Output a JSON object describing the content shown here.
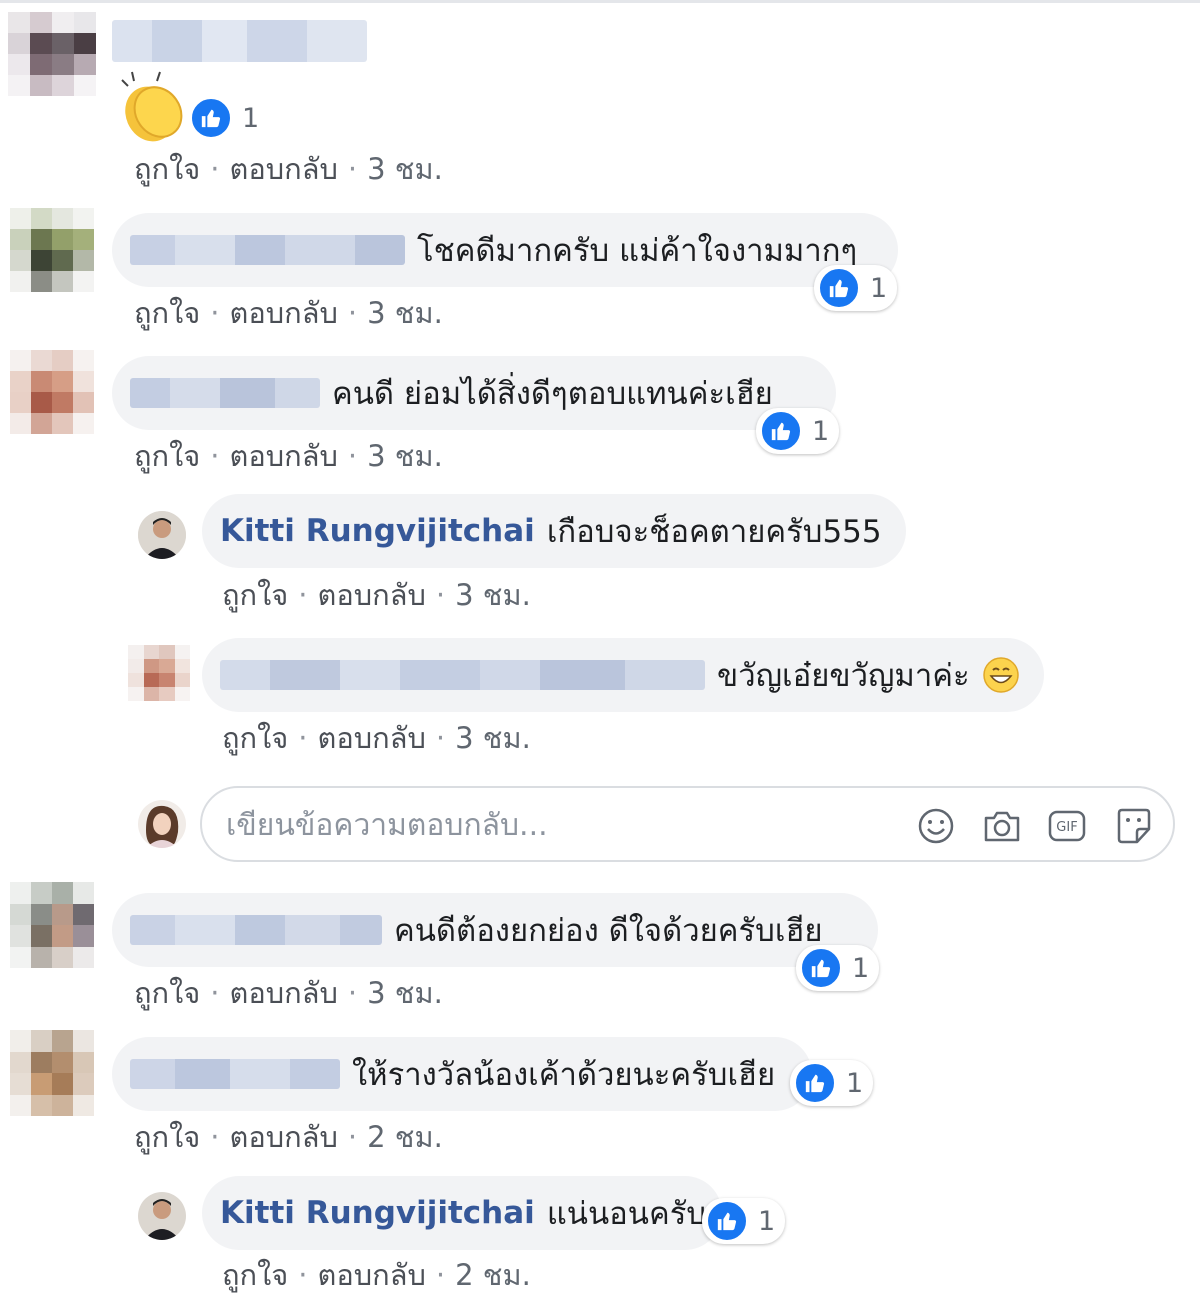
{
  "actions": {
    "like": "ถูกใจ",
    "reply": "ตอบกลับ",
    "separator": "·"
  },
  "comments": [
    {
      "text": "",
      "time": "3 ชม.",
      "reaction_count": "1",
      "sticker": "clapping-hands-emoji"
    },
    {
      "text": "โชคดีมากครับ แม่ค้าใจงามมากๆ",
      "time": "3 ชม.",
      "reaction_count": "1"
    },
    {
      "text": "คนดี ย่อมได้สิ่งดีๆตอบแทนค่ะเฮีย",
      "time": "3 ชม.",
      "reaction_count": "1"
    },
    {
      "author": "Kitti Rungvijitchai",
      "text": "เกือบจะช็อคตายครับ555",
      "time": "3 ชม."
    },
    {
      "text": "ขวัญเอ๋ยขวัญมาค่ะ",
      "emoji": "grinning-face",
      "time": "3 ชม."
    },
    {
      "text": "คนดีต้องยกย่อง ดีใจด้วยครับเฮีย",
      "time": "3 ชม.",
      "reaction_count": "1"
    },
    {
      "text": "ให้รางวัลน้องเค้าด้วยนะครับเฮีย",
      "time": "2 ชม.",
      "reaction_count": "1"
    },
    {
      "author": "Kitti Rungvijitchai",
      "text": "แน่นอนครับ",
      "time": "2 ชม.",
      "reaction_count": "1"
    }
  ],
  "reply_box": {
    "placeholder": "เขียนข้อความตอบกลับ...",
    "icons": [
      "emoji-icon",
      "camera-icon",
      "gif-icon",
      "sticker-icon"
    ]
  },
  "colors": {
    "like_blue": "#1877f2",
    "author_blue": "#365899",
    "bubble_gray": "#f2f3f5"
  }
}
